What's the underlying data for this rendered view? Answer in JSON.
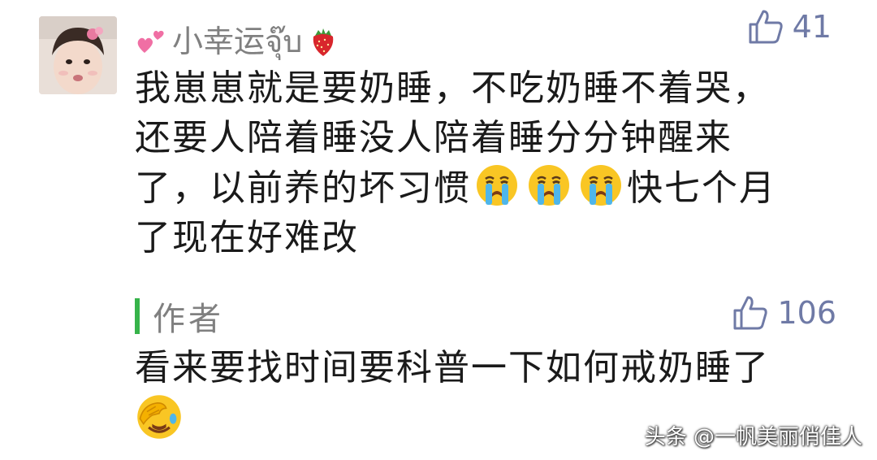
{
  "comment": {
    "username": "小幸运จุ๊บ",
    "likes": "41",
    "lines": [
      "我崽崽就是要奶睡，不吃奶睡不着哭，",
      "还要人陪着睡没人陪着睡分分钟醒来",
      "了，以前养的坏习惯",
      "快七个月",
      "了现在好难改"
    ],
    "icons": {
      "name_prefix": "two-hearts-icon",
      "name_suffix": "strawberry-icon",
      "inline": [
        "crying-face-icon",
        "crying-face-icon",
        "crying-face-icon"
      ]
    }
  },
  "reply": {
    "author": "作者",
    "likes": "106",
    "text": "看来要找时间要科普一下如何戒奶睡了",
    "icon": "face-palm-laughing-icon"
  },
  "watermark": "头条 @一帆美丽俏佳人",
  "colors": {
    "reply_bar": "#36b34a",
    "like": "#6f7aa6",
    "username": "#808080"
  }
}
